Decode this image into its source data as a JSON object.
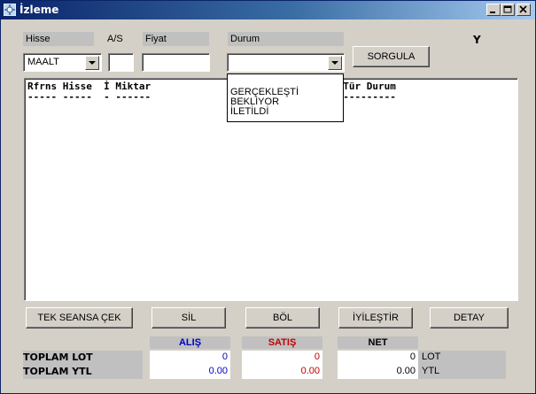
{
  "window": {
    "title": "İzleme"
  },
  "form": {
    "labels": {
      "hisse": "Hisse",
      "as": "A/S",
      "fiyat": "Fiyat",
      "durum": "Durum"
    },
    "hisse_value": "MAALT",
    "as_value": "",
    "fiyat_value": "",
    "durum_value": "",
    "query_button": "SORGULA",
    "y_indicator": "Y"
  },
  "durum_dropdown": {
    "options": [
      "GERÇEKLEŞTİ",
      "BEKLİYOR",
      "İLETİLDİ"
    ]
  },
  "results": {
    "header_line": "Rfrns Hisse  İ Miktar",
    "header_line_right": "S Tür Durum",
    "underline_left": "----- -----  - ------",
    "underline_right": "- ---------"
  },
  "buttons": {
    "tek_seansa_cek": "TEK SEANSA ÇEK",
    "sil": "SİL",
    "bol": "BÖL",
    "iyilestir": "İYİLEŞTİR",
    "detay": "DETAY"
  },
  "totals": {
    "headers": {
      "alis": "ALIŞ",
      "satis": "SATIŞ",
      "net": "NET"
    },
    "rows": [
      {
        "label": "TOPLAM LOT",
        "alis": "0",
        "satis": "0",
        "net": "0",
        "unit": "LOT"
      },
      {
        "label": "TOPLAM YTL",
        "alis": "0.00",
        "satis": "0.00",
        "net": "0.00",
        "unit": "YTL"
      }
    ]
  },
  "colors": {
    "alis": "#0000c0",
    "satis": "#c00000",
    "titlebar": "#0a246a"
  }
}
